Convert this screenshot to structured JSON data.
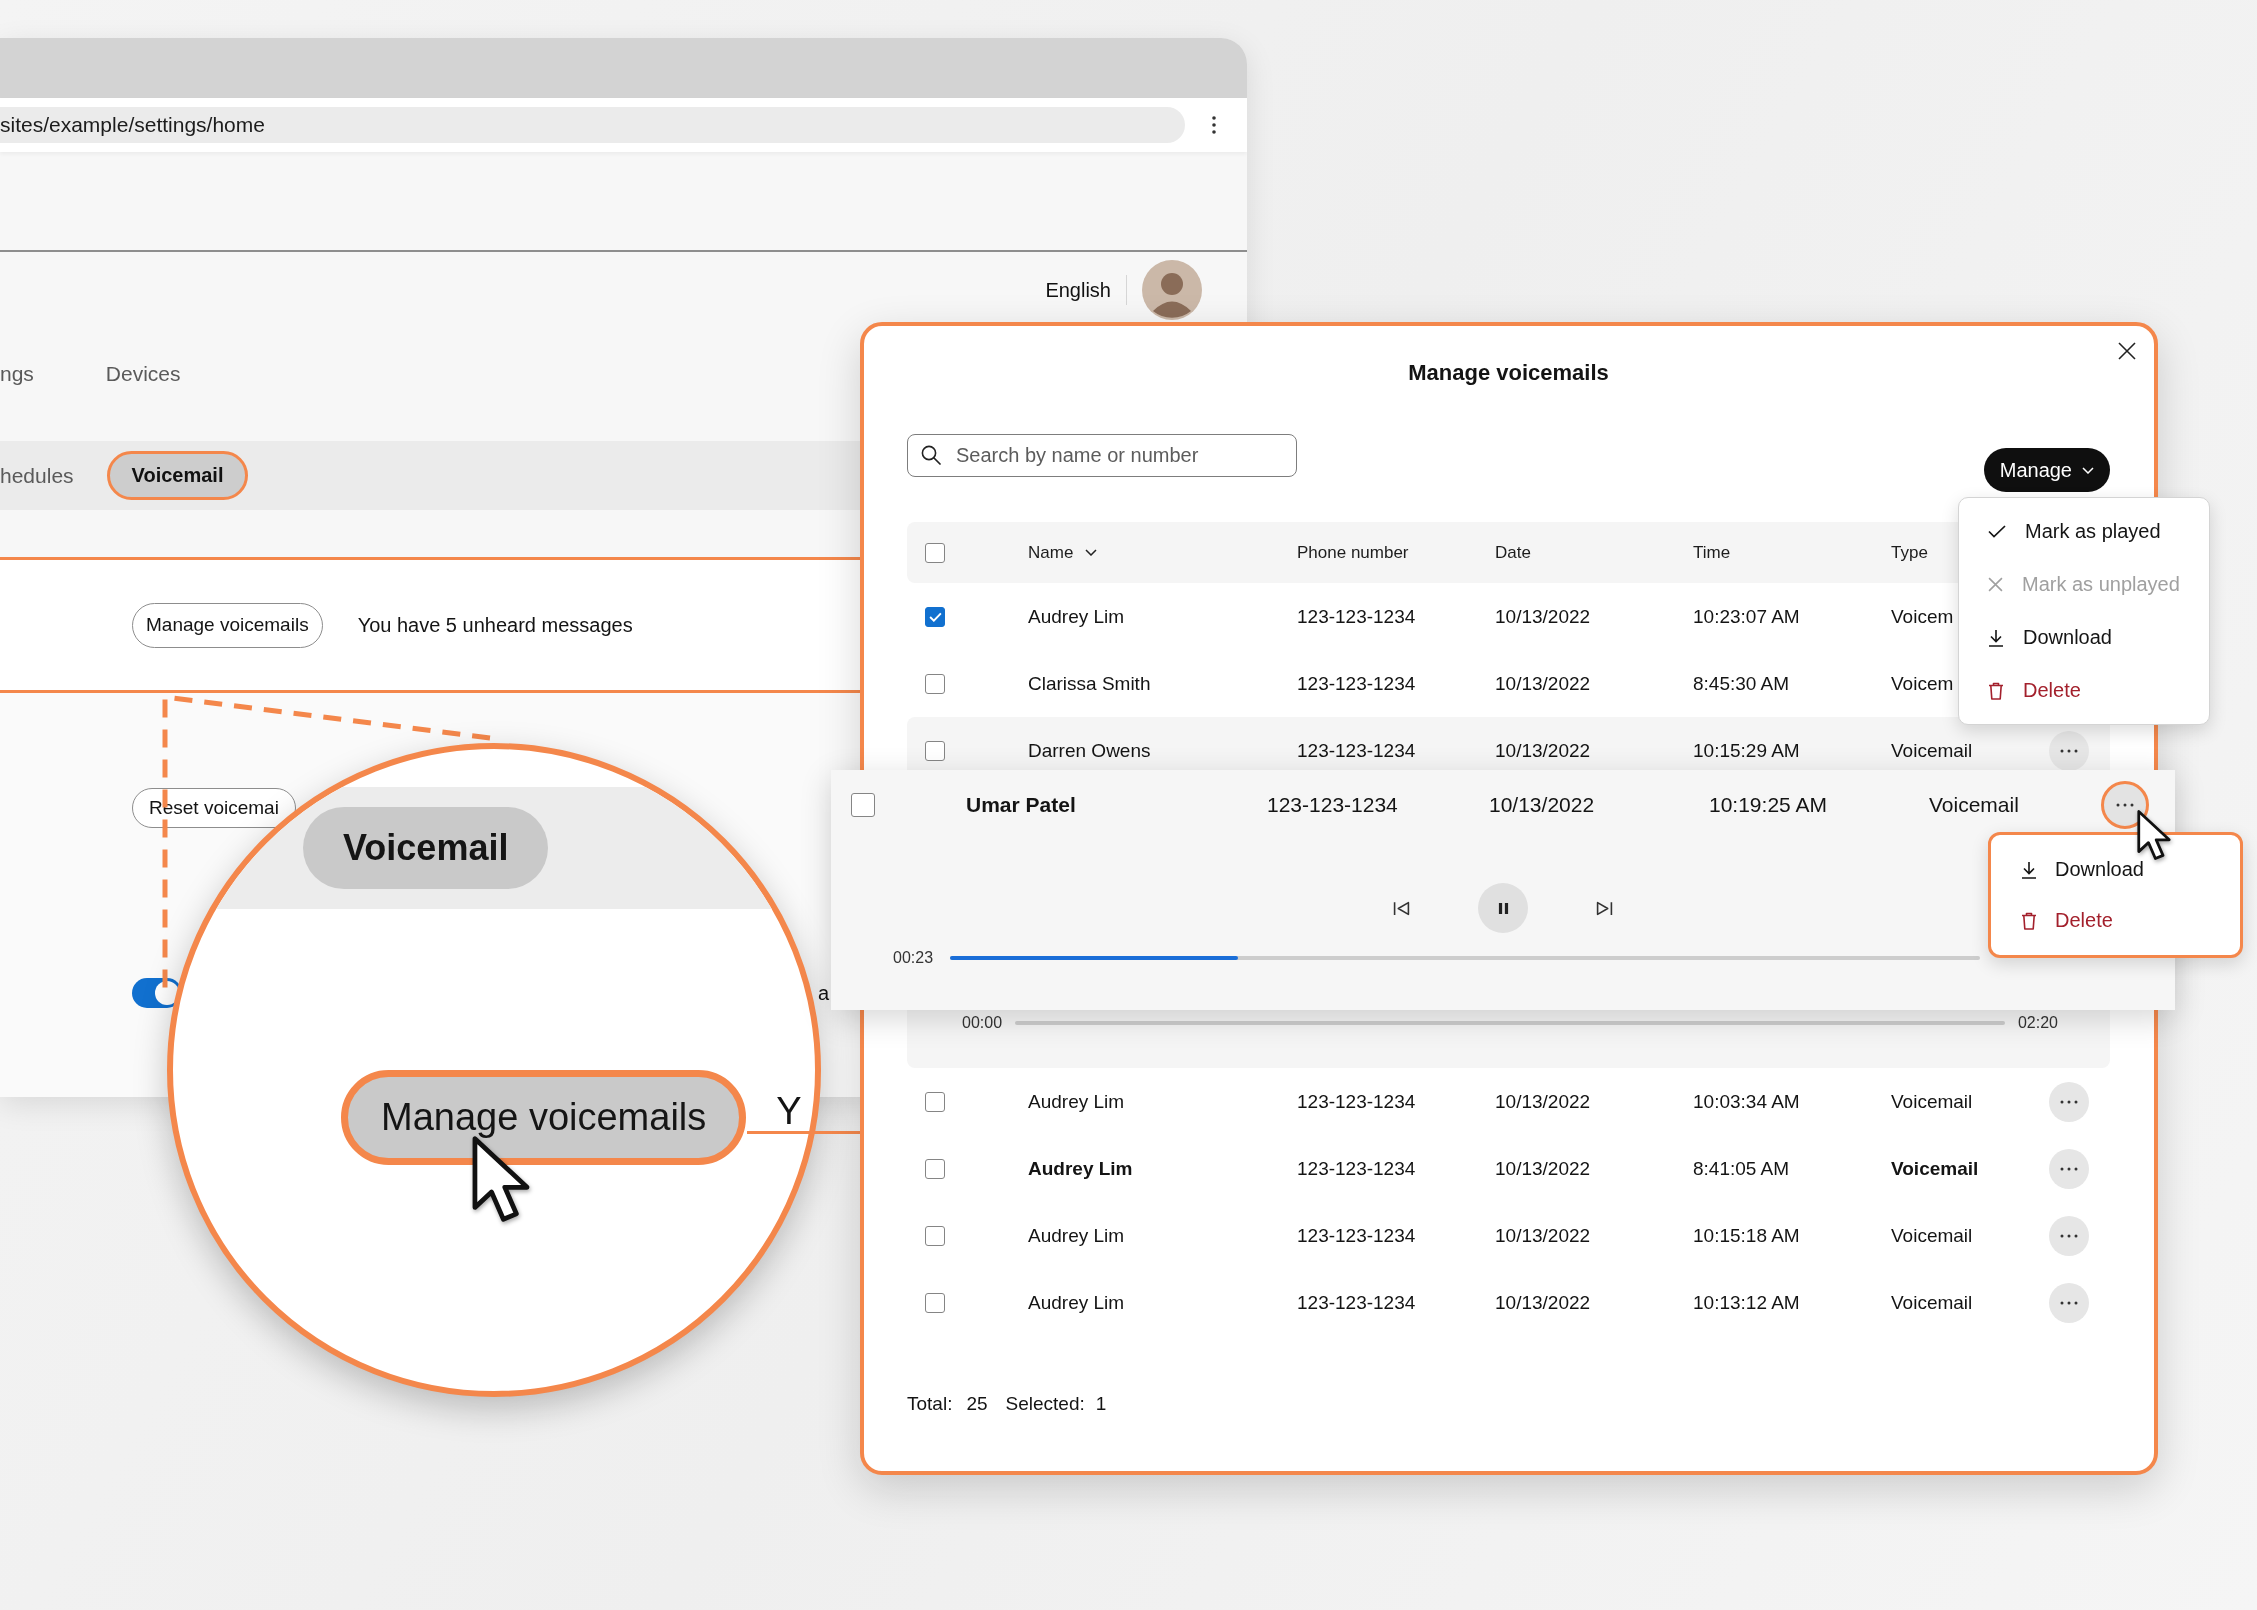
{
  "browser": {
    "url": "sites/example/settings/home",
    "language": "English",
    "nav_tabs": [
      {
        "label": "ngs",
        "selected": false
      },
      {
        "label": "Devices",
        "selected": false
      }
    ],
    "sub_tabs": [
      {
        "label": "hedules",
        "selected": false,
        "highlighted": false
      },
      {
        "label": "Voicemail",
        "selected": true,
        "highlighted": true
      }
    ],
    "voicemail_section": {
      "button": "Manage voicemails",
      "message": "You have 5 unheard messages",
      "highlighted": true
    },
    "reset_button": "Reset voicemai",
    "toggle": {
      "on": true
    },
    "text_fragment": "a"
  },
  "magnifier": {
    "tab": {
      "label": "Voicemail",
      "selected": true
    },
    "button": {
      "label": "Manage voicemails",
      "highlighted": true
    },
    "text_fragment": "Y"
  },
  "modal": {
    "title": "Manage voicemails",
    "search": {
      "placeholder": "Search by name or number"
    },
    "manage_button": "Manage",
    "table": {
      "select_all": {
        "checked": false
      },
      "columns": [
        {
          "label": "Name",
          "sorted": true
        },
        {
          "label": "Phone number",
          "sorted": false
        },
        {
          "label": "Date",
          "sorted": false
        },
        {
          "label": "Time",
          "sorted": false
        },
        {
          "label": "Type",
          "sorted": false
        }
      ],
      "rows": [
        {
          "selected": true,
          "name": "Audrey Lim",
          "phone": "123-123-1234",
          "date": "10/13/2022",
          "time": "10:23:07 AM",
          "type": "Voicem",
          "unheard": false,
          "expanded": false
        },
        {
          "selected": false,
          "name": "Clarissa Smith",
          "phone": "123-123-1234",
          "date": "10/13/2022",
          "time": "8:45:30 AM",
          "type": "Voicem",
          "unheard": false,
          "expanded": false
        },
        {
          "selected": false,
          "name": "Darren Owens",
          "phone": "123-123-1234",
          "date": "10/13/2022",
          "time": "10:15:29 AM",
          "type": "Voicemail",
          "unheard": false,
          "more_button": true,
          "expanded": true,
          "player": {
            "start": "00:00",
            "end": "02:20"
          }
        },
        {
          "selected": false,
          "name": "Audrey Lim",
          "phone": "123-123-1234",
          "date": "10/13/2022",
          "time": "10:03:34 AM",
          "type": "Voicemail",
          "unheard": false,
          "more_button": true,
          "expanded": false
        },
        {
          "selected": false,
          "name": "Audrey Lim",
          "phone": "123-123-1234",
          "date": "10/13/2022",
          "time": "8:41:05 AM",
          "type": "Voicemail",
          "unheard": true,
          "more_button": true,
          "expanded": false
        },
        {
          "selected": false,
          "name": "Audrey Lim",
          "phone": "123-123-1234",
          "date": "10/13/2022",
          "time": "10:15:18 AM",
          "type": "Voicemail",
          "unheard": false,
          "more_button": true,
          "expanded": false
        },
        {
          "selected": false,
          "name": "Audrey Lim",
          "phone": "123-123-1234",
          "date": "10/13/2022",
          "time": "10:13:12 AM",
          "type": "Voicemail",
          "unheard": false,
          "more_button": true,
          "expanded": false
        }
      ]
    },
    "footer": {
      "total_label": "Total:",
      "total": "25",
      "selected_label": "Selected:",
      "selected": "1"
    }
  },
  "manage_menu": {
    "items": [
      {
        "kind": "check",
        "label": "Mark as played",
        "disabled": false,
        "danger": false
      },
      {
        "kind": "cross",
        "label": "Mark as unplayed",
        "disabled": true,
        "danger": false
      },
      {
        "kind": "download",
        "label": "Download",
        "disabled": false,
        "danger": false
      },
      {
        "kind": "trash",
        "label": "Delete",
        "disabled": false,
        "danger": true
      }
    ]
  },
  "expanded_card": {
    "row": {
      "selected": false,
      "name": "Umar Patel",
      "phone": "123-123-1234",
      "date": "10/13/2022",
      "time": "10:19:25 AM",
      "type": "Voicemail",
      "menu_open": true
    },
    "player": {
      "elapsed": "00:23",
      "level": 0.28,
      "playing": true
    }
  },
  "row_menu": {
    "items": [
      {
        "kind": "download",
        "label": "Download",
        "danger": false
      },
      {
        "kind": "trash",
        "label": "Delete",
        "danger": true
      }
    ]
  }
}
